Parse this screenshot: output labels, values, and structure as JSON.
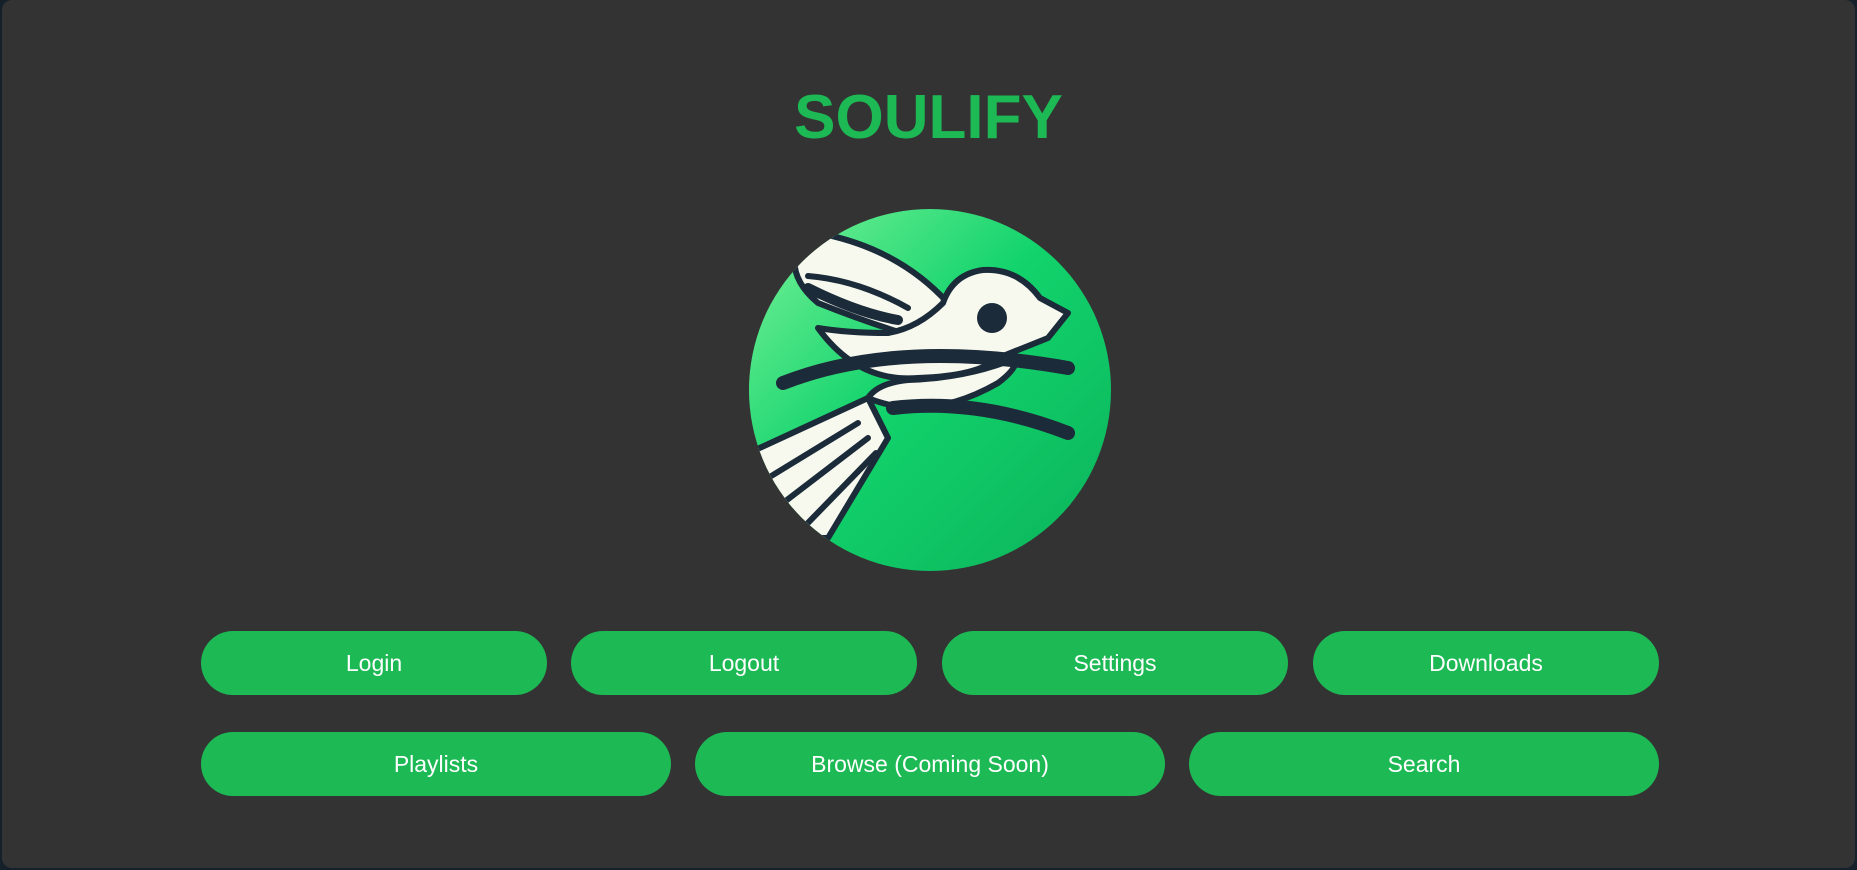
{
  "app": {
    "title": "SOULIFY",
    "logo_icon": "bird-logo-icon"
  },
  "colors": {
    "accent": "#1db954",
    "background": "#333333",
    "frame": "#15202b",
    "button_text": "#ffffff"
  },
  "buttons": {
    "login": "Login",
    "logout": "Logout",
    "settings": "Settings",
    "downloads": "Downloads",
    "playlists": "Playlists",
    "browse": "Browse (Coming Soon)",
    "search": "Search"
  }
}
